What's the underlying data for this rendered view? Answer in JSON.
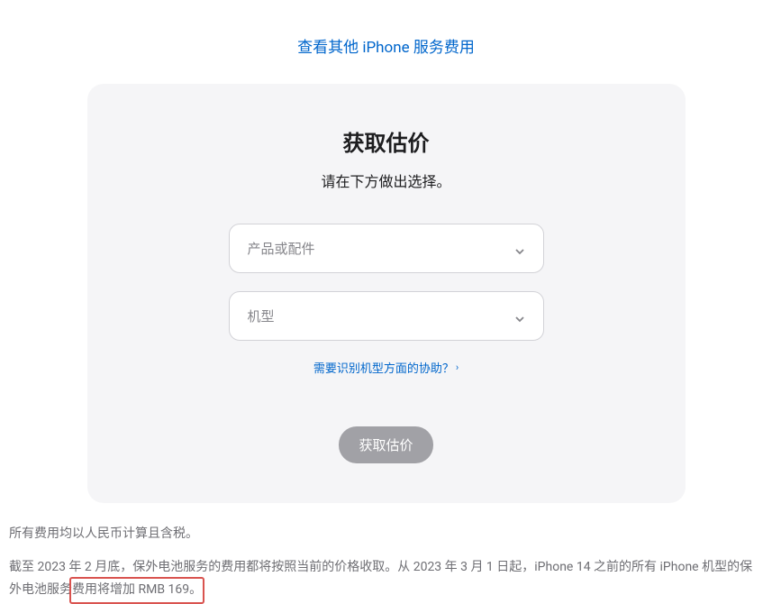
{
  "top_link": "查看其他 iPhone 服务费用",
  "card": {
    "title": "获取估价",
    "subtitle": "请在下方做出选择。",
    "select1": "产品或配件",
    "select2": "机型",
    "help_link": "需要识别机型方面的协助？",
    "submit": "获取估价"
  },
  "footer": {
    "line1": "所有费用均以人民币计算且含税。",
    "line2_part1": "截至 2023 年 2 月底，保外电池服务的费用都将按照当前的价格收取。从 2023 年 3 月 1 日起，iPhone 14 之前的所有 iPhone 机型的保外电池服务",
    "highlight": "费用将增加 RMB 169。"
  }
}
